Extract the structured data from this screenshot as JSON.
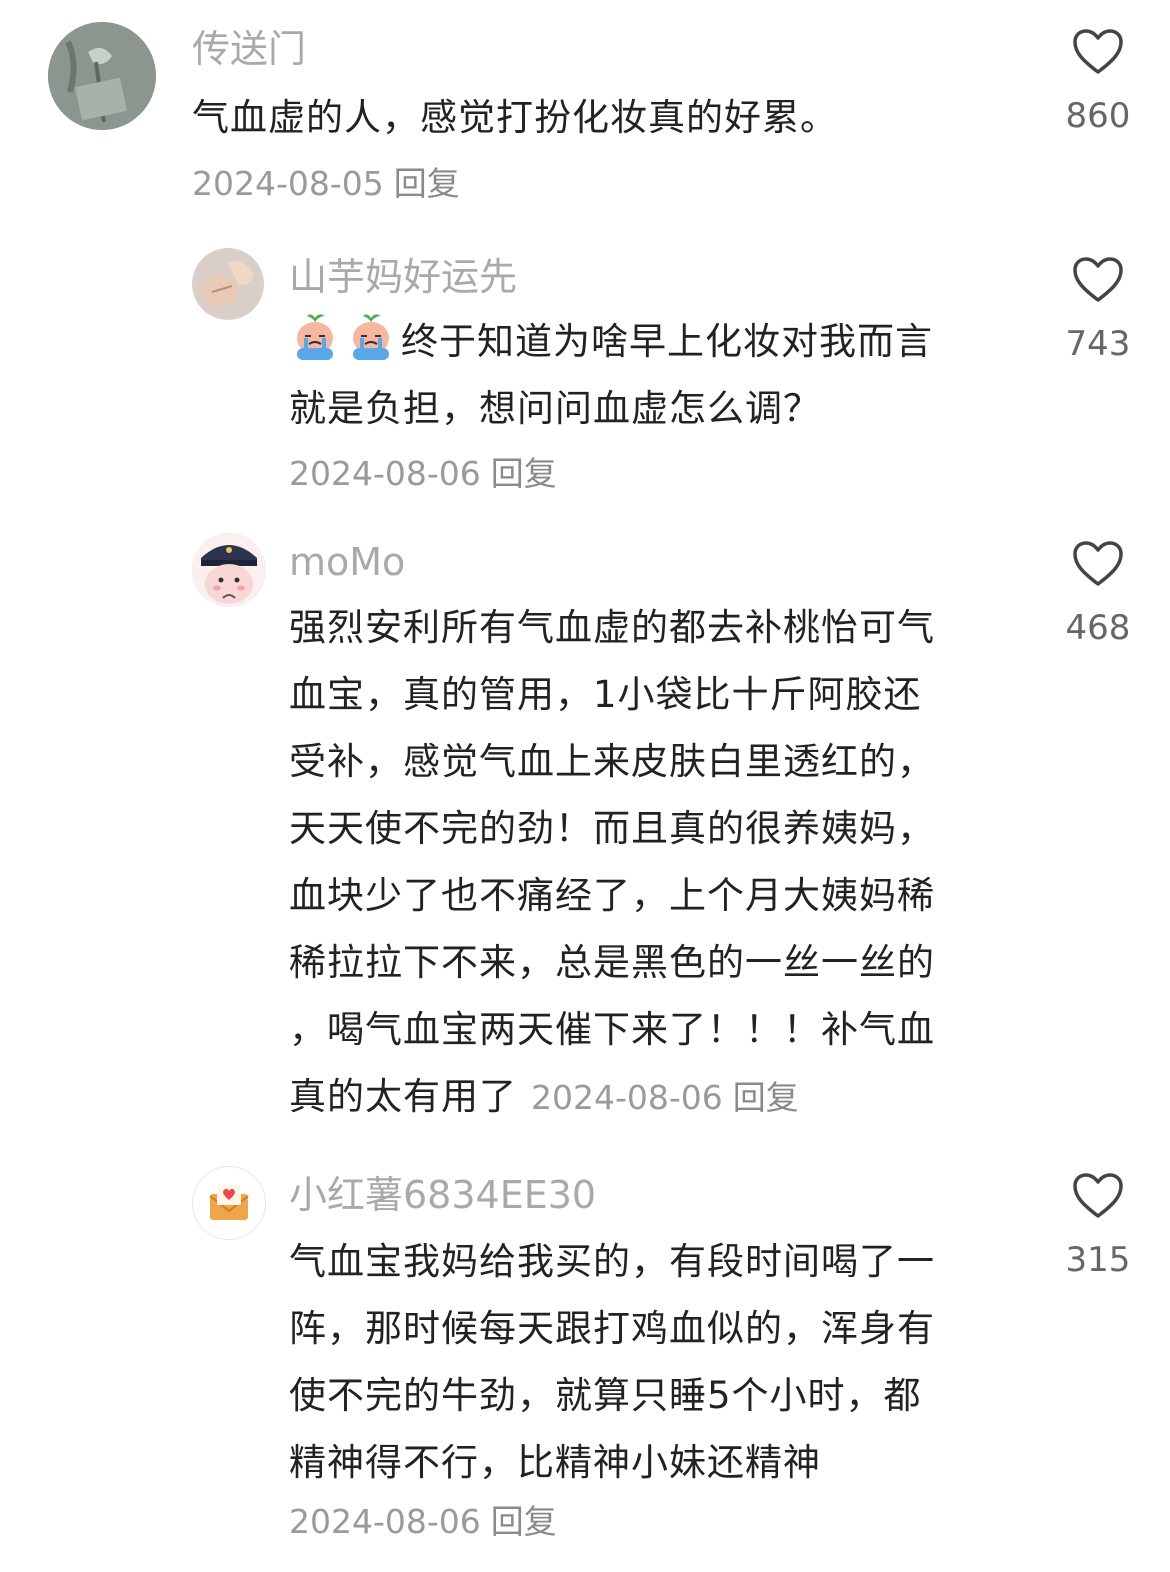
{
  "comments": [
    {
      "username": "传送门",
      "lines": [
        "气血虚的人，感觉打扮化妆真的好累。"
      ],
      "date": "2024-08-05",
      "reply": "回复",
      "likes": "860",
      "avatar_icon": "rose-photo-avatar"
    },
    {
      "username": "山芋妈好运先",
      "emoji_icons": [
        "crying-peach-emoji",
        "crying-peach-emoji"
      ],
      "lines": [
        "终于知道为啥早上化妆对我而言",
        "就是负担，想问问血虚怎么调？"
      ],
      "date": "2024-08-06",
      "reply": "回复",
      "likes": "743",
      "avatar_icon": "hands-photo-avatar"
    },
    {
      "username": "moMo",
      "lines": [
        "强烈安利所有气血虚的都去补桃怡可气",
        "血宝，真的管用，1小袋比十斤阿胶还",
        "受补，感觉气血上来皮肤白里透红的，",
        "天天使不完的劲！而且真的很养姨妈，",
        "血块少了也不痛经了，上个月大姨妈稀",
        "稀拉拉下不来，总是黑色的一丝一丝的",
        "，喝气血宝两天催下来了！！！补气血",
        "真的太有用了"
      ],
      "date": "2024-08-06",
      "reply": "回复",
      "likes": "468",
      "avatar_icon": "cartoon-police-avatar"
    },
    {
      "username": "小红薯6834EE30",
      "lines": [
        "气血宝我妈给我买的，有段时间喝了一",
        "阵，那时候每天跟打鸡血似的，浑身有",
        "使不完的牛劲，就算只睡5个小时，都",
        "精神得不行，比精神小妹还精神"
      ],
      "date": "2024-08-06",
      "reply": "回复",
      "likes": "315",
      "avatar_icon": "envelope-heart-avatar"
    }
  ],
  "colors": {
    "username": "#a9a9a9",
    "text": "#222222",
    "meta": "#9a9a9a",
    "heart_outline": "#444444"
  }
}
